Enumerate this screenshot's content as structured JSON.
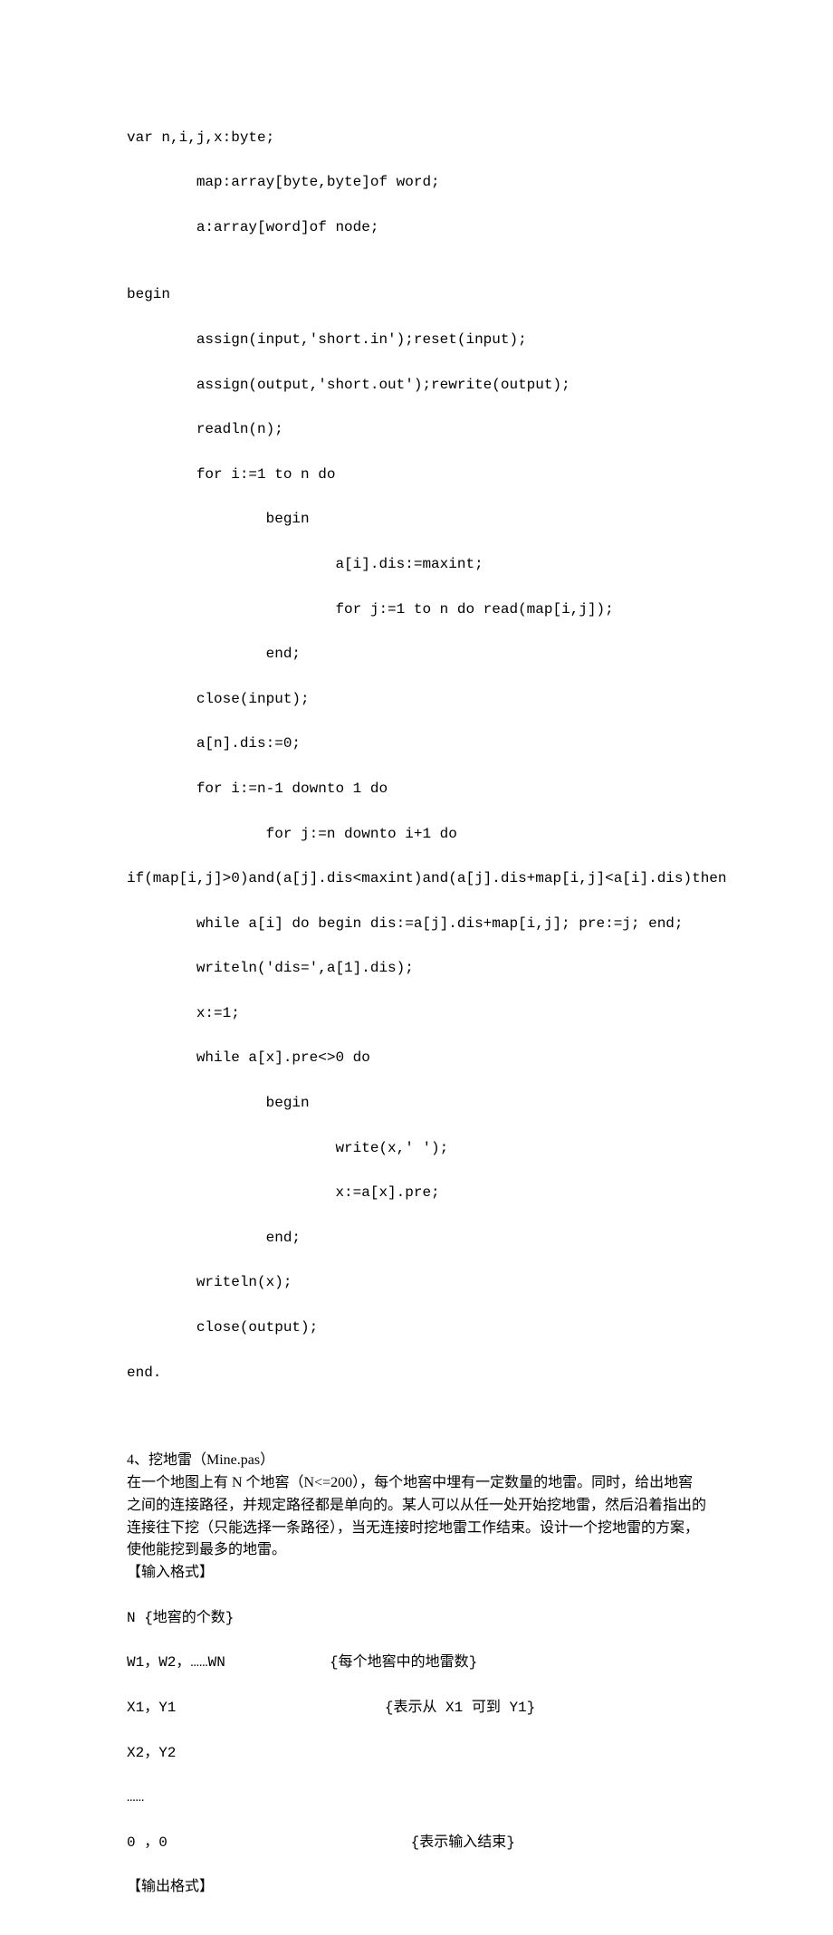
{
  "code": {
    "l1": "var n,i,j,x:byte;",
    "l2": "        map:array[byte,byte]of word;",
    "l3": "        a:array[word]of node;",
    "l4": "",
    "l5": "begin",
    "l6": "        assign(input,'short.in');reset(input);",
    "l7": "        assign(output,'short.out');rewrite(output);",
    "l8": "        readln(n);",
    "l9": "        for i:=1 to n do",
    "l10": "                begin",
    "l11": "                        a[i].dis:=maxint;",
    "l12": "                        for j:=1 to n do read(map[i,j]);",
    "l13": "                end;",
    "l14": "        close(input);",
    "l15": "        a[n].dis:=0;",
    "l16": "        for i:=n-1 downto 1 do",
    "l17": "                for j:=n downto i+1 do",
    "l18": "if(map[i,j]>0)and(a[j].dis<maxint)and(a[j].dis+map[i,j]<a[i].dis)then",
    "l19": "        while a[i] do begin dis:=a[j].dis+map[i,j]; pre:=j; end;",
    "l20": "        writeln('dis=',a[1].dis);",
    "l21": "        x:=1;",
    "l22": "        while a[x].pre<>0 do",
    "l23": "                begin",
    "l24": "                        write(x,' ');",
    "l25": "                        x:=a[x].pre;",
    "l26": "                end;",
    "l27": "        writeln(x);",
    "l28": "        close(output);",
    "l29": "end."
  },
  "prose": {
    "title": "4、挖地雷（Mine.pas）",
    "p1": "在一个地图上有 N 个地窖（N<=200），每个地窖中埋有一定数量的地雷。同时，给出地窖之间的连接路径，并规定路径都是单向的。某人可以从任一处开始挖地雷，然后沿着指出的连接往下挖（只能选择一条路径），当无连接时挖地雷工作结束。设计一个挖地雷的方案，使他能挖到最多的地雷。",
    "in_hdr": "【输入格式】",
    "in_l1": "N {地窖的个数}",
    "in_l2": "W1，W2，……WN            {每个地窖中的地雷数}",
    "in_l3": "X1，Y1                        {表示从 X1 可到 Y1}",
    "in_l4": "X2，Y2",
    "in_l5": "……",
    "in_l6": "0 ，0                            {表示输入结束}",
    "out_hdr": "【输出格式】"
  }
}
